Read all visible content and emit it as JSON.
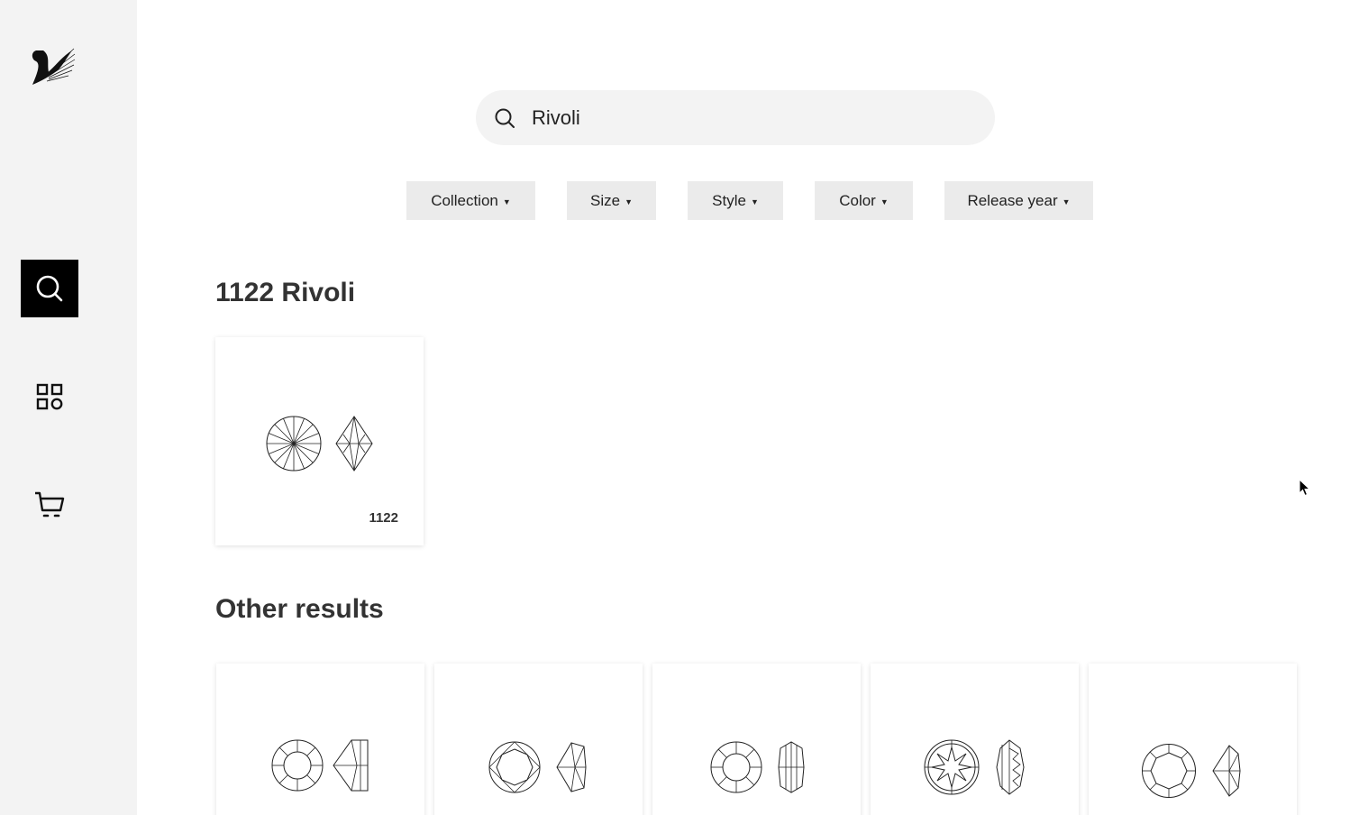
{
  "sidebar": {
    "logo_icon": "swan-logo-icon",
    "nav": [
      {
        "name": "search",
        "icon": "search-icon",
        "active": true
      },
      {
        "name": "catalog",
        "icon": "grid-icon",
        "active": false
      },
      {
        "name": "cart",
        "icon": "cart-icon",
        "active": false
      }
    ]
  },
  "search": {
    "value": "Rivoli",
    "placeholder": ""
  },
  "filters": [
    {
      "label": "Collection"
    },
    {
      "label": "Size"
    },
    {
      "label": "Style"
    },
    {
      "label": "Color"
    },
    {
      "label": "Release year"
    }
  ],
  "main_result": {
    "title": "1122 Rivoli",
    "card": {
      "code": "1122"
    }
  },
  "other_results": {
    "title": "Other results",
    "cards": [
      {
        "code": ""
      },
      {
        "code": ""
      },
      {
        "code": ""
      },
      {
        "code": ""
      },
      {
        "code": ""
      }
    ]
  },
  "colors": {
    "sidebar_bg": "#f3f3f3",
    "active_nav": "#000000",
    "filter_bg": "#ebebeb"
  }
}
